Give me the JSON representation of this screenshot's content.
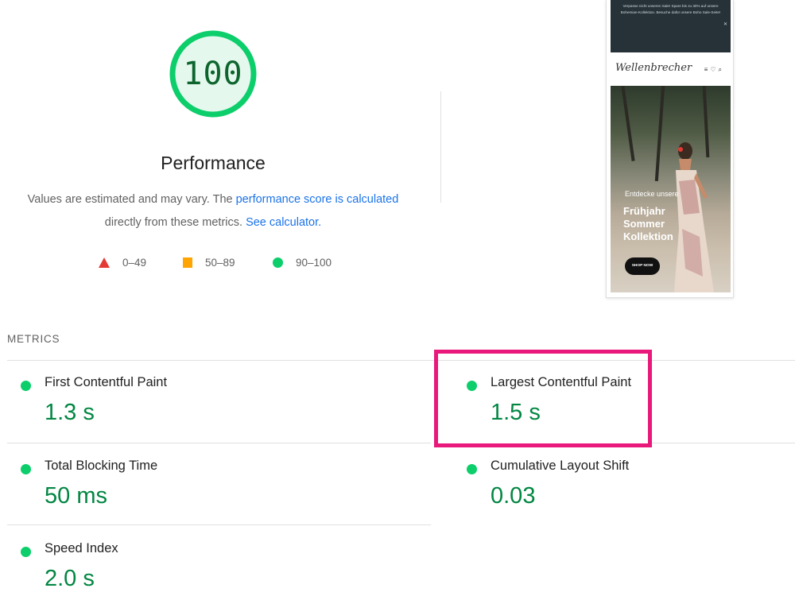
{
  "performance": {
    "score": "100",
    "title": "Performance",
    "desc_prefix": "Values are estimated and may vary. The ",
    "desc_link1": "performance score is calculated",
    "desc_middle": "directly from these metrics. ",
    "desc_link2": "See calculator."
  },
  "legend": [
    {
      "range": "0–49",
      "shape": "triangle",
      "color": "#e53935"
    },
    {
      "range": "50–89",
      "shape": "square",
      "color": "#ffa400"
    },
    {
      "range": "90–100",
      "shape": "circle",
      "color": "#0cce6b"
    }
  ],
  "screenshot": {
    "banner_text": "Verpasse nicht unseren Sale! Spare bis zu 30% auf unsere Bohemian-Kollektion. Besuche dafür unsere Boho Sale-Seite!",
    "logo": "Wellenbrecher",
    "hero_small": "Entdecke unsere",
    "hero_line1": "Frühjahr",
    "hero_line2": "Sommer",
    "hero_line3": "Kollektion",
    "hero_button": "SHOP NOW"
  },
  "metrics": {
    "header": "METRICS",
    "items": [
      {
        "title": "First Contentful Paint",
        "value": "1.3 s",
        "status_color": "#0cce6b"
      },
      {
        "title": "Largest Contentful Paint",
        "value": "1.5 s",
        "status_color": "#0cce6b"
      },
      {
        "title": "Total Blocking Time",
        "value": "50 ms",
        "status_color": "#0cce6b"
      },
      {
        "title": "Cumulative Layout Shift",
        "value": "0.03",
        "status_color": "#0cce6b"
      },
      {
        "title": "Speed Index",
        "value": "2.0 s",
        "status_color": "#0cce6b"
      }
    ]
  },
  "colors": {
    "pass": "#0cce6b",
    "pass_text": "#018642",
    "link": "#1a73e8",
    "highlight": "#e8197a"
  }
}
